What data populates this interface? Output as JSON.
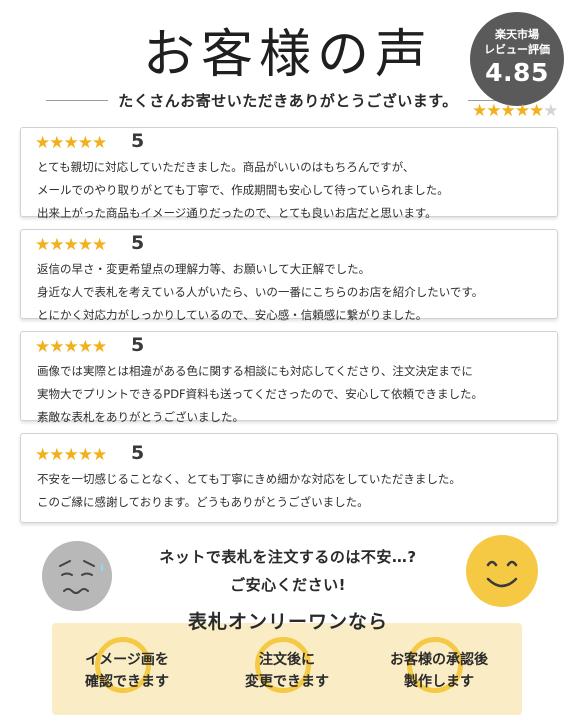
{
  "header": {
    "title": "お客様の声",
    "subtitle": "たくさんお寄せいただきありがとうございます。"
  },
  "badge": {
    "line1": "楽天市場",
    "line2": "レビュー評価",
    "score": "4.85",
    "stars_rating": 4.85
  },
  "colors": {
    "star": "#f2b01e",
    "badge_bg": "#5a5a5a",
    "accent_yellow": "#f6c945",
    "feature_bg": "#faedc5"
  },
  "reviews": [
    {
      "stars": 5,
      "score": "5",
      "lines": [
        "とても親切に対応していただきました。商品がいいのはもちろんですが、",
        "メールでのやり取りがとても丁寧で、作成期間も安心して待っていられました。",
        "出来上がった商品もイメージ通りだったので、とても良いお店だと思います。"
      ]
    },
    {
      "stars": 5,
      "score": "5",
      "lines": [
        "返信の早さ・変更希望点の理解力等、お願いして大正解でした。",
        "身近な人で表札を考えている人がいたら、いの一番にこちらのお店を紹介したいです。",
        "とにかく対応力がしっかりしているので、安心感・信頼感に繋がりました。"
      ]
    },
    {
      "stars": 5,
      "score": "5",
      "lines": [
        "画像では実際とは相違がある色に関する相談にも対応してくださり、注文決定までに",
        "実物大でプリントできるPDF資料も送ってくださったので、安心して依頼できました。",
        "素敵な表札をありがとうございました。"
      ]
    },
    {
      "stars": 5,
      "score": "5",
      "lines": [
        "不安を一切感じることなく、とても丁寧にきめ細かな対応をしていただきました。",
        "このご縁に感謝しております。どうもありがとうございました。"
      ]
    }
  ],
  "question": {
    "line1": "ネットで表札を注文するのは不安…?",
    "line2": "ご安心ください!"
  },
  "features": {
    "title": "表札オンリーワンなら",
    "items": [
      {
        "line1": "イメージ画を",
        "line2": "確認できます"
      },
      {
        "line1": "注文後に",
        "line2": "変更できます"
      },
      {
        "line1": "お客様の承認後",
        "line2": "製作します"
      }
    ]
  }
}
